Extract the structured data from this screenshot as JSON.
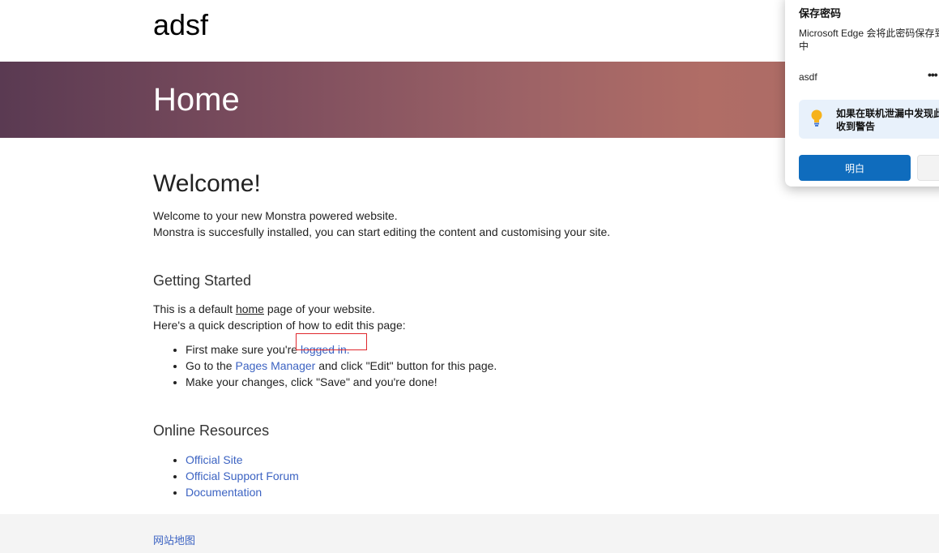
{
  "site": {
    "title": "adsf"
  },
  "hero": {
    "title": "Home"
  },
  "welcome": {
    "heading": "Welcome!",
    "line1": "Welcome to your new Monstra powered website.",
    "line2": "Monstra is succesfully installed, you can start editing the content and customising your site."
  },
  "getting_started": {
    "heading": "Getting Started",
    "line1_prefix": "This is a default ",
    "line1_link": "home",
    "line1_suffix": " page of your website.",
    "line2": "Here's a quick description of how to edit this page:",
    "step1_prefix": "First make sure you're ",
    "step1_link": "logged in.",
    "step2_prefix": "Go to the ",
    "step2_link": "Pages Manager",
    "step2_suffix": " and click \"Edit\" button for this page.",
    "step3": "Make your changes, click \"Save\" and you're done!"
  },
  "online_resources": {
    "heading": "Online Resources",
    "links": [
      "Official Site",
      "Official Support Forum",
      "Documentation"
    ]
  },
  "footer": {
    "sitemap_link": "网站地图"
  },
  "password_popup": {
    "title": "保存密码",
    "description": "Microsoft Edge 会将此密码保存到\n中",
    "username": "asdf",
    "more_icon": "more-icon",
    "tip_icon": "lightbulb-icon",
    "tip_text": "如果在联机泄漏中发现此\n收到警告",
    "ok_button": "明白",
    "accent_color": "#0f6cbd"
  },
  "colors": {
    "link": "#3c63c2",
    "highlight_box": "#e0282e"
  }
}
